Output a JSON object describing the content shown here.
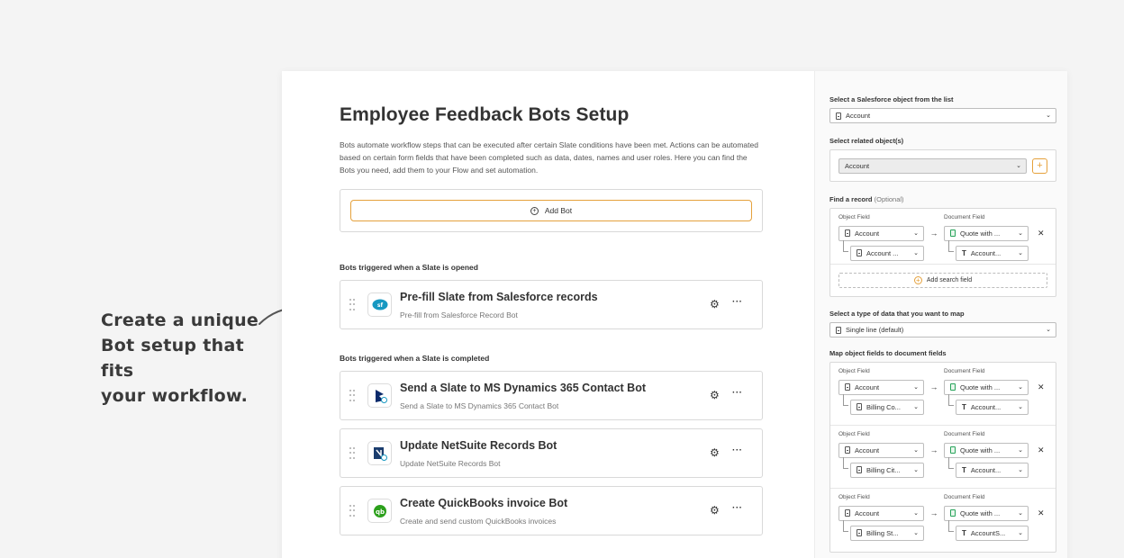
{
  "callout": {
    "line1": "Create a unique",
    "line2": "Bot setup that fits",
    "line3": "your workflow."
  },
  "page": {
    "title": "Employee Feedback Bots Setup",
    "description": "Bots automate workflow steps that can be executed after certain Slate conditions have been met. Actions can be automated based on certain form fields that have been completed such as data, dates, names and user roles. Here you can find the Bots you need, add them to your Flow and set automation.",
    "add_bot_label": "Add Bot"
  },
  "sections": {
    "opened_label": "Bots triggered when a Slate is opened",
    "completed_label": "Bots triggered when a Slate is completed"
  },
  "bots_opened": [
    {
      "title": "Pre-fill Slate from Salesforce records",
      "subtitle": "Pre-fill from Salesforce Record Bot",
      "icon": "salesforce-icon"
    }
  ],
  "bots_completed": [
    {
      "title": "Send a Slate to MS Dynamics 365 Contact Bot",
      "subtitle": "Send a Slate to MS Dynamics 365 Contact Bot",
      "icon": "ms-dynamics-icon"
    },
    {
      "title": "Update NetSuite Records Bot",
      "subtitle": "Update NetSuite Records Bot",
      "icon": "netsuite-icon"
    },
    {
      "title": "Create QuickBooks invoice Bot",
      "subtitle": "Create and send custom QuickBooks invoices",
      "icon": "quickbooks-icon"
    }
  ],
  "panel": {
    "object_label": "Select a Salesforce object from the list",
    "object_value": "Account",
    "related_label": "Select related object(s)",
    "related_value": "Account",
    "find_label": "Find a record",
    "find_optional": "(Optional)",
    "object_field_head": "Object Field",
    "document_field_head": "Document Field",
    "find_row": {
      "obj": "Account",
      "doc": "Quote with ...",
      "sub_obj": "Account ...",
      "sub_doc": "Account..."
    },
    "add_search_label": "Add search field",
    "datatype_label": "Select a type of data that you want to map",
    "datatype_value": "Single line (default)",
    "map_label": "Map object fields to document fields",
    "map_rows": [
      {
        "obj": "Account",
        "doc": "Quote with ...",
        "sub_obj": "Billing Co...",
        "sub_doc": "Account..."
      },
      {
        "obj": "Account",
        "doc": "Quote with ...",
        "sub_obj": "Billing Cit...",
        "sub_doc": "Account..."
      },
      {
        "obj": "Account",
        "doc": "Quote with ...",
        "sub_obj": "Billing St...",
        "sub_doc": "AccountS..."
      }
    ]
  },
  "colors": {
    "accent": "#e5a13c",
    "salesforce": "#1798c1",
    "quickbooks": "#2ca01c"
  }
}
